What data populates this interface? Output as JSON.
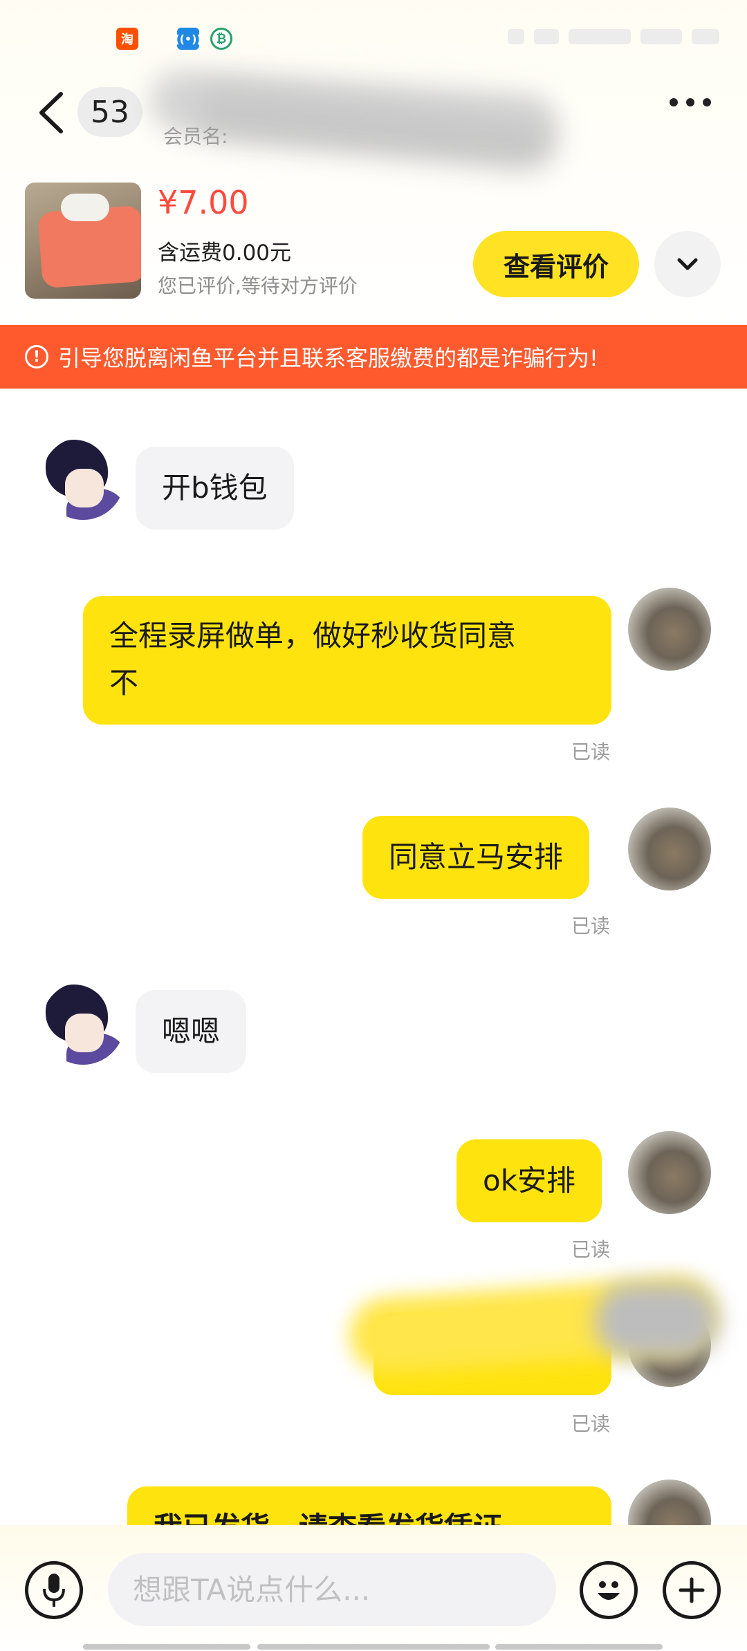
{
  "status_bar": {
    "icons": [
      "taobao-icon",
      "wifi-hotspot-icon",
      "app-icon"
    ]
  },
  "header": {
    "unread_count": "53",
    "member_label": "会员名:"
  },
  "product": {
    "price": "¥7.00",
    "shipping": "含运费0.00元",
    "review_status": "您已评价,等待对方评价",
    "view_review_label": "查看评价"
  },
  "warning": {
    "text": "引导您脱离闲鱼平台并且联系客服缴费的都是诈骗行为!"
  },
  "messages": [
    {
      "from": "other",
      "text": "开b钱包"
    },
    {
      "from": "self",
      "line1": "全程录屏做单，做好秒收货同意",
      "line2": "不",
      "status": "已读"
    },
    {
      "from": "self",
      "text": "同意立马安排",
      "status": "已读"
    },
    {
      "from": "other",
      "text": "嗯嗯"
    },
    {
      "from": "self",
      "text": "ok安排",
      "status": "已读"
    },
    {
      "from": "self",
      "text": "",
      "status": "已读"
    },
    {
      "from": "self",
      "text": "我已发货，请查看发货凭证"
    }
  ],
  "composer": {
    "placeholder": "想跟TA说点什么..."
  },
  "colors": {
    "accent_yellow": "#ffe30e",
    "warning_red": "#ff5a2e",
    "price_red": "#ff4a3d"
  }
}
